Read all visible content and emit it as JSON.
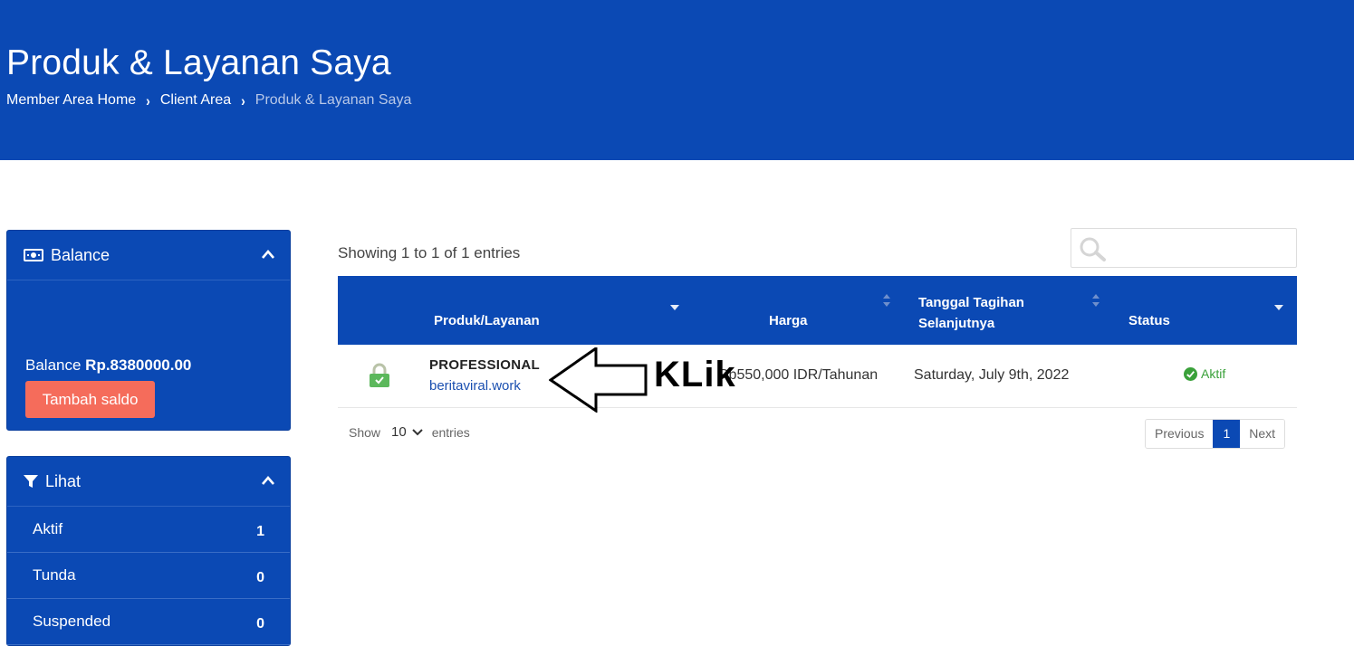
{
  "header": {
    "title": "Produk & Layanan Saya",
    "breadcrumb": [
      "Member Area Home",
      "Client Area",
      "Produk & Layanan Saya"
    ]
  },
  "colors": {
    "primary": "#0b49b4",
    "accent": "#f56c5b",
    "success": "#3aa13a"
  },
  "balance_panel": {
    "title": "Balance",
    "label": "Balance",
    "amount": "Rp.8380000.00",
    "topup_button": "Tambah saldo",
    "icon": "money-icon"
  },
  "filter_panel": {
    "title": "Lihat",
    "icon": "filter-icon",
    "items": [
      {
        "label": "Aktif",
        "count": "1"
      },
      {
        "label": "Tunda",
        "count": "0"
      },
      {
        "label": "Suspended",
        "count": "0"
      }
    ]
  },
  "table": {
    "showing": "Showing 1 to 1 of 1 entries",
    "search_placeholder": "",
    "columns": [
      "Produk/Layanan",
      "Harga",
      "Tanggal Tagihan Selanjutnya",
      "Status"
    ],
    "column_due_line1": "Tanggal Tagihan",
    "column_due_line2": "Selanjutnya",
    "rows": [
      {
        "product": "PROFESSIONAL",
        "domain": "beritaviral.work",
        "price": "Rp550,000 IDR/Tahunan",
        "due_date": "Saturday, July 9th, 2022",
        "status": "Aktif"
      }
    ],
    "show_label": "Show",
    "entries_label": "entries",
    "page_size": "10",
    "pagination": {
      "previous": "Previous",
      "current": "1",
      "next": "Next"
    }
  },
  "annotation": {
    "text": "KLik"
  }
}
